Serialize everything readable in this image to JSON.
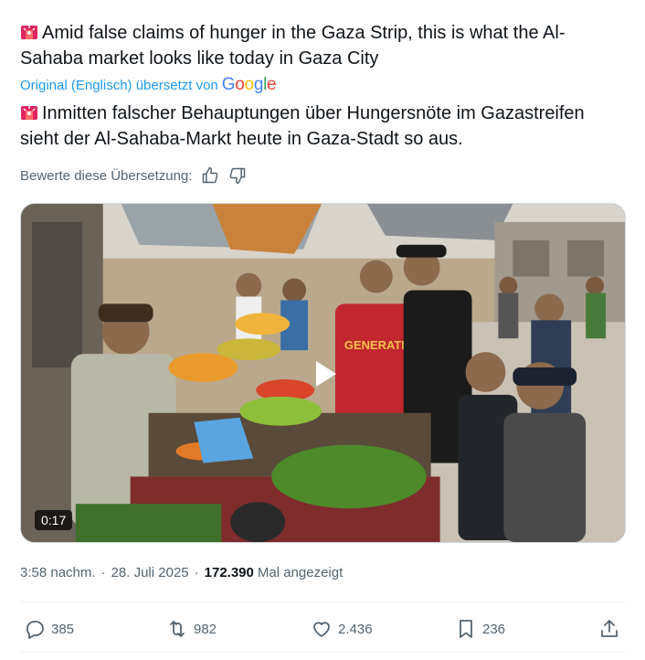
{
  "tweet": {
    "text": "Amid false claims of hunger in the Gaza Strip, this is what the Al-Sahaba market looks like today in Gaza City",
    "translated_by_label": "Original (Englisch) übersetzt von",
    "translation": "Inmitten falscher Behauptungen über Hungersnöte im Gazastreifen sieht der Al-Sahaba-Markt heute in Gaza-Stadt so aus.",
    "rate_label": "Bewerte diese Übersetzung:"
  },
  "google": {
    "g1": "G",
    "o1": "o",
    "o2": "o",
    "g2": "g",
    "l": "l",
    "e": "e"
  },
  "media": {
    "duration": "0:17",
    "shirt_text": "GENERATION IRON"
  },
  "meta": {
    "time": "3:58 nachm.",
    "separator": "·",
    "date": "28. Juli 2025",
    "views": "172.390",
    "views_label": "Mal angezeigt"
  },
  "actions": {
    "replies": "385",
    "reposts": "982",
    "likes": "2.436",
    "bookmarks": "236"
  },
  "icons": {
    "siren": "police-car-light-emoji",
    "like": "thumbs-up-icon",
    "dislike": "thumbs-down-icon",
    "play": "play-icon",
    "reply": "speech-bubble-icon",
    "repost": "retweet-icon",
    "heart": "heart-icon",
    "bookmark": "bookmark-icon",
    "share": "share-icon"
  },
  "colors": {
    "link": "#1d9bf0",
    "secondary_text": "#536471",
    "primary_text": "#0f1419"
  }
}
